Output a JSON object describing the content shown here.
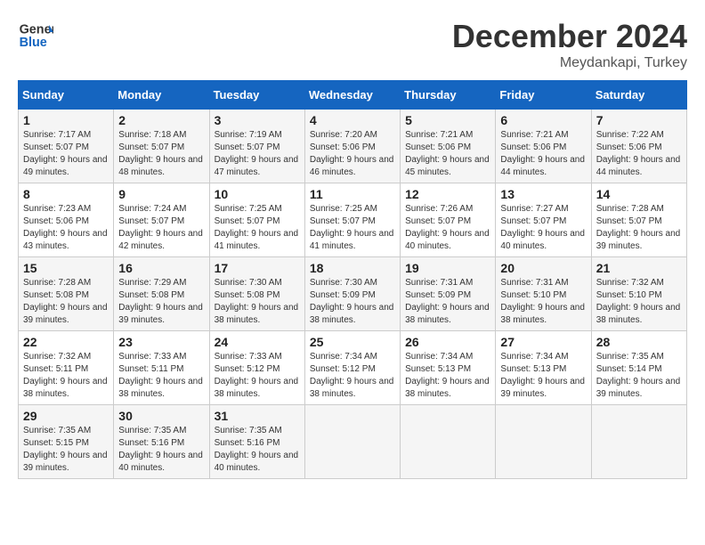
{
  "header": {
    "logo_line1": "General",
    "logo_line2": "Blue",
    "month": "December 2024",
    "location": "Meydankapi, Turkey"
  },
  "weekdays": [
    "Sunday",
    "Monday",
    "Tuesday",
    "Wednesday",
    "Thursday",
    "Friday",
    "Saturday"
  ],
  "weeks": [
    [
      {
        "day": "1",
        "sunrise": "Sunrise: 7:17 AM",
        "sunset": "Sunset: 5:07 PM",
        "daylight": "Daylight: 9 hours and 49 minutes."
      },
      {
        "day": "2",
        "sunrise": "Sunrise: 7:18 AM",
        "sunset": "Sunset: 5:07 PM",
        "daylight": "Daylight: 9 hours and 48 minutes."
      },
      {
        "day": "3",
        "sunrise": "Sunrise: 7:19 AM",
        "sunset": "Sunset: 5:07 PM",
        "daylight": "Daylight: 9 hours and 47 minutes."
      },
      {
        "day": "4",
        "sunrise": "Sunrise: 7:20 AM",
        "sunset": "Sunset: 5:06 PM",
        "daylight": "Daylight: 9 hours and 46 minutes."
      },
      {
        "day": "5",
        "sunrise": "Sunrise: 7:21 AM",
        "sunset": "Sunset: 5:06 PM",
        "daylight": "Daylight: 9 hours and 45 minutes."
      },
      {
        "day": "6",
        "sunrise": "Sunrise: 7:21 AM",
        "sunset": "Sunset: 5:06 PM",
        "daylight": "Daylight: 9 hours and 44 minutes."
      },
      {
        "day": "7",
        "sunrise": "Sunrise: 7:22 AM",
        "sunset": "Sunset: 5:06 PM",
        "daylight": "Daylight: 9 hours and 44 minutes."
      }
    ],
    [
      {
        "day": "8",
        "sunrise": "Sunrise: 7:23 AM",
        "sunset": "Sunset: 5:06 PM",
        "daylight": "Daylight: 9 hours and 43 minutes."
      },
      {
        "day": "9",
        "sunrise": "Sunrise: 7:24 AM",
        "sunset": "Sunset: 5:07 PM",
        "daylight": "Daylight: 9 hours and 42 minutes."
      },
      {
        "day": "10",
        "sunrise": "Sunrise: 7:25 AM",
        "sunset": "Sunset: 5:07 PM",
        "daylight": "Daylight: 9 hours and 41 minutes."
      },
      {
        "day": "11",
        "sunrise": "Sunrise: 7:25 AM",
        "sunset": "Sunset: 5:07 PM",
        "daylight": "Daylight: 9 hours and 41 minutes."
      },
      {
        "day": "12",
        "sunrise": "Sunrise: 7:26 AM",
        "sunset": "Sunset: 5:07 PM",
        "daylight": "Daylight: 9 hours and 40 minutes."
      },
      {
        "day": "13",
        "sunrise": "Sunrise: 7:27 AM",
        "sunset": "Sunset: 5:07 PM",
        "daylight": "Daylight: 9 hours and 40 minutes."
      },
      {
        "day": "14",
        "sunrise": "Sunrise: 7:28 AM",
        "sunset": "Sunset: 5:07 PM",
        "daylight": "Daylight: 9 hours and 39 minutes."
      }
    ],
    [
      {
        "day": "15",
        "sunrise": "Sunrise: 7:28 AM",
        "sunset": "Sunset: 5:08 PM",
        "daylight": "Daylight: 9 hours and 39 minutes."
      },
      {
        "day": "16",
        "sunrise": "Sunrise: 7:29 AM",
        "sunset": "Sunset: 5:08 PM",
        "daylight": "Daylight: 9 hours and 39 minutes."
      },
      {
        "day": "17",
        "sunrise": "Sunrise: 7:30 AM",
        "sunset": "Sunset: 5:08 PM",
        "daylight": "Daylight: 9 hours and 38 minutes."
      },
      {
        "day": "18",
        "sunrise": "Sunrise: 7:30 AM",
        "sunset": "Sunset: 5:09 PM",
        "daylight": "Daylight: 9 hours and 38 minutes."
      },
      {
        "day": "19",
        "sunrise": "Sunrise: 7:31 AM",
        "sunset": "Sunset: 5:09 PM",
        "daylight": "Daylight: 9 hours and 38 minutes."
      },
      {
        "day": "20",
        "sunrise": "Sunrise: 7:31 AM",
        "sunset": "Sunset: 5:10 PM",
        "daylight": "Daylight: 9 hours and 38 minutes."
      },
      {
        "day": "21",
        "sunrise": "Sunrise: 7:32 AM",
        "sunset": "Sunset: 5:10 PM",
        "daylight": "Daylight: 9 hours and 38 minutes."
      }
    ],
    [
      {
        "day": "22",
        "sunrise": "Sunrise: 7:32 AM",
        "sunset": "Sunset: 5:11 PM",
        "daylight": "Daylight: 9 hours and 38 minutes."
      },
      {
        "day": "23",
        "sunrise": "Sunrise: 7:33 AM",
        "sunset": "Sunset: 5:11 PM",
        "daylight": "Daylight: 9 hours and 38 minutes."
      },
      {
        "day": "24",
        "sunrise": "Sunrise: 7:33 AM",
        "sunset": "Sunset: 5:12 PM",
        "daylight": "Daylight: 9 hours and 38 minutes."
      },
      {
        "day": "25",
        "sunrise": "Sunrise: 7:34 AM",
        "sunset": "Sunset: 5:12 PM",
        "daylight": "Daylight: 9 hours and 38 minutes."
      },
      {
        "day": "26",
        "sunrise": "Sunrise: 7:34 AM",
        "sunset": "Sunset: 5:13 PM",
        "daylight": "Daylight: 9 hours and 38 minutes."
      },
      {
        "day": "27",
        "sunrise": "Sunrise: 7:34 AM",
        "sunset": "Sunset: 5:13 PM",
        "daylight": "Daylight: 9 hours and 39 minutes."
      },
      {
        "day": "28",
        "sunrise": "Sunrise: 7:35 AM",
        "sunset": "Sunset: 5:14 PM",
        "daylight": "Daylight: 9 hours and 39 minutes."
      }
    ],
    [
      {
        "day": "29",
        "sunrise": "Sunrise: 7:35 AM",
        "sunset": "Sunset: 5:15 PM",
        "daylight": "Daylight: 9 hours and 39 minutes."
      },
      {
        "day": "30",
        "sunrise": "Sunrise: 7:35 AM",
        "sunset": "Sunset: 5:16 PM",
        "daylight": "Daylight: 9 hours and 40 minutes."
      },
      {
        "day": "31",
        "sunrise": "Sunrise: 7:35 AM",
        "sunset": "Sunset: 5:16 PM",
        "daylight": "Daylight: 9 hours and 40 minutes."
      },
      null,
      null,
      null,
      null
    ]
  ]
}
